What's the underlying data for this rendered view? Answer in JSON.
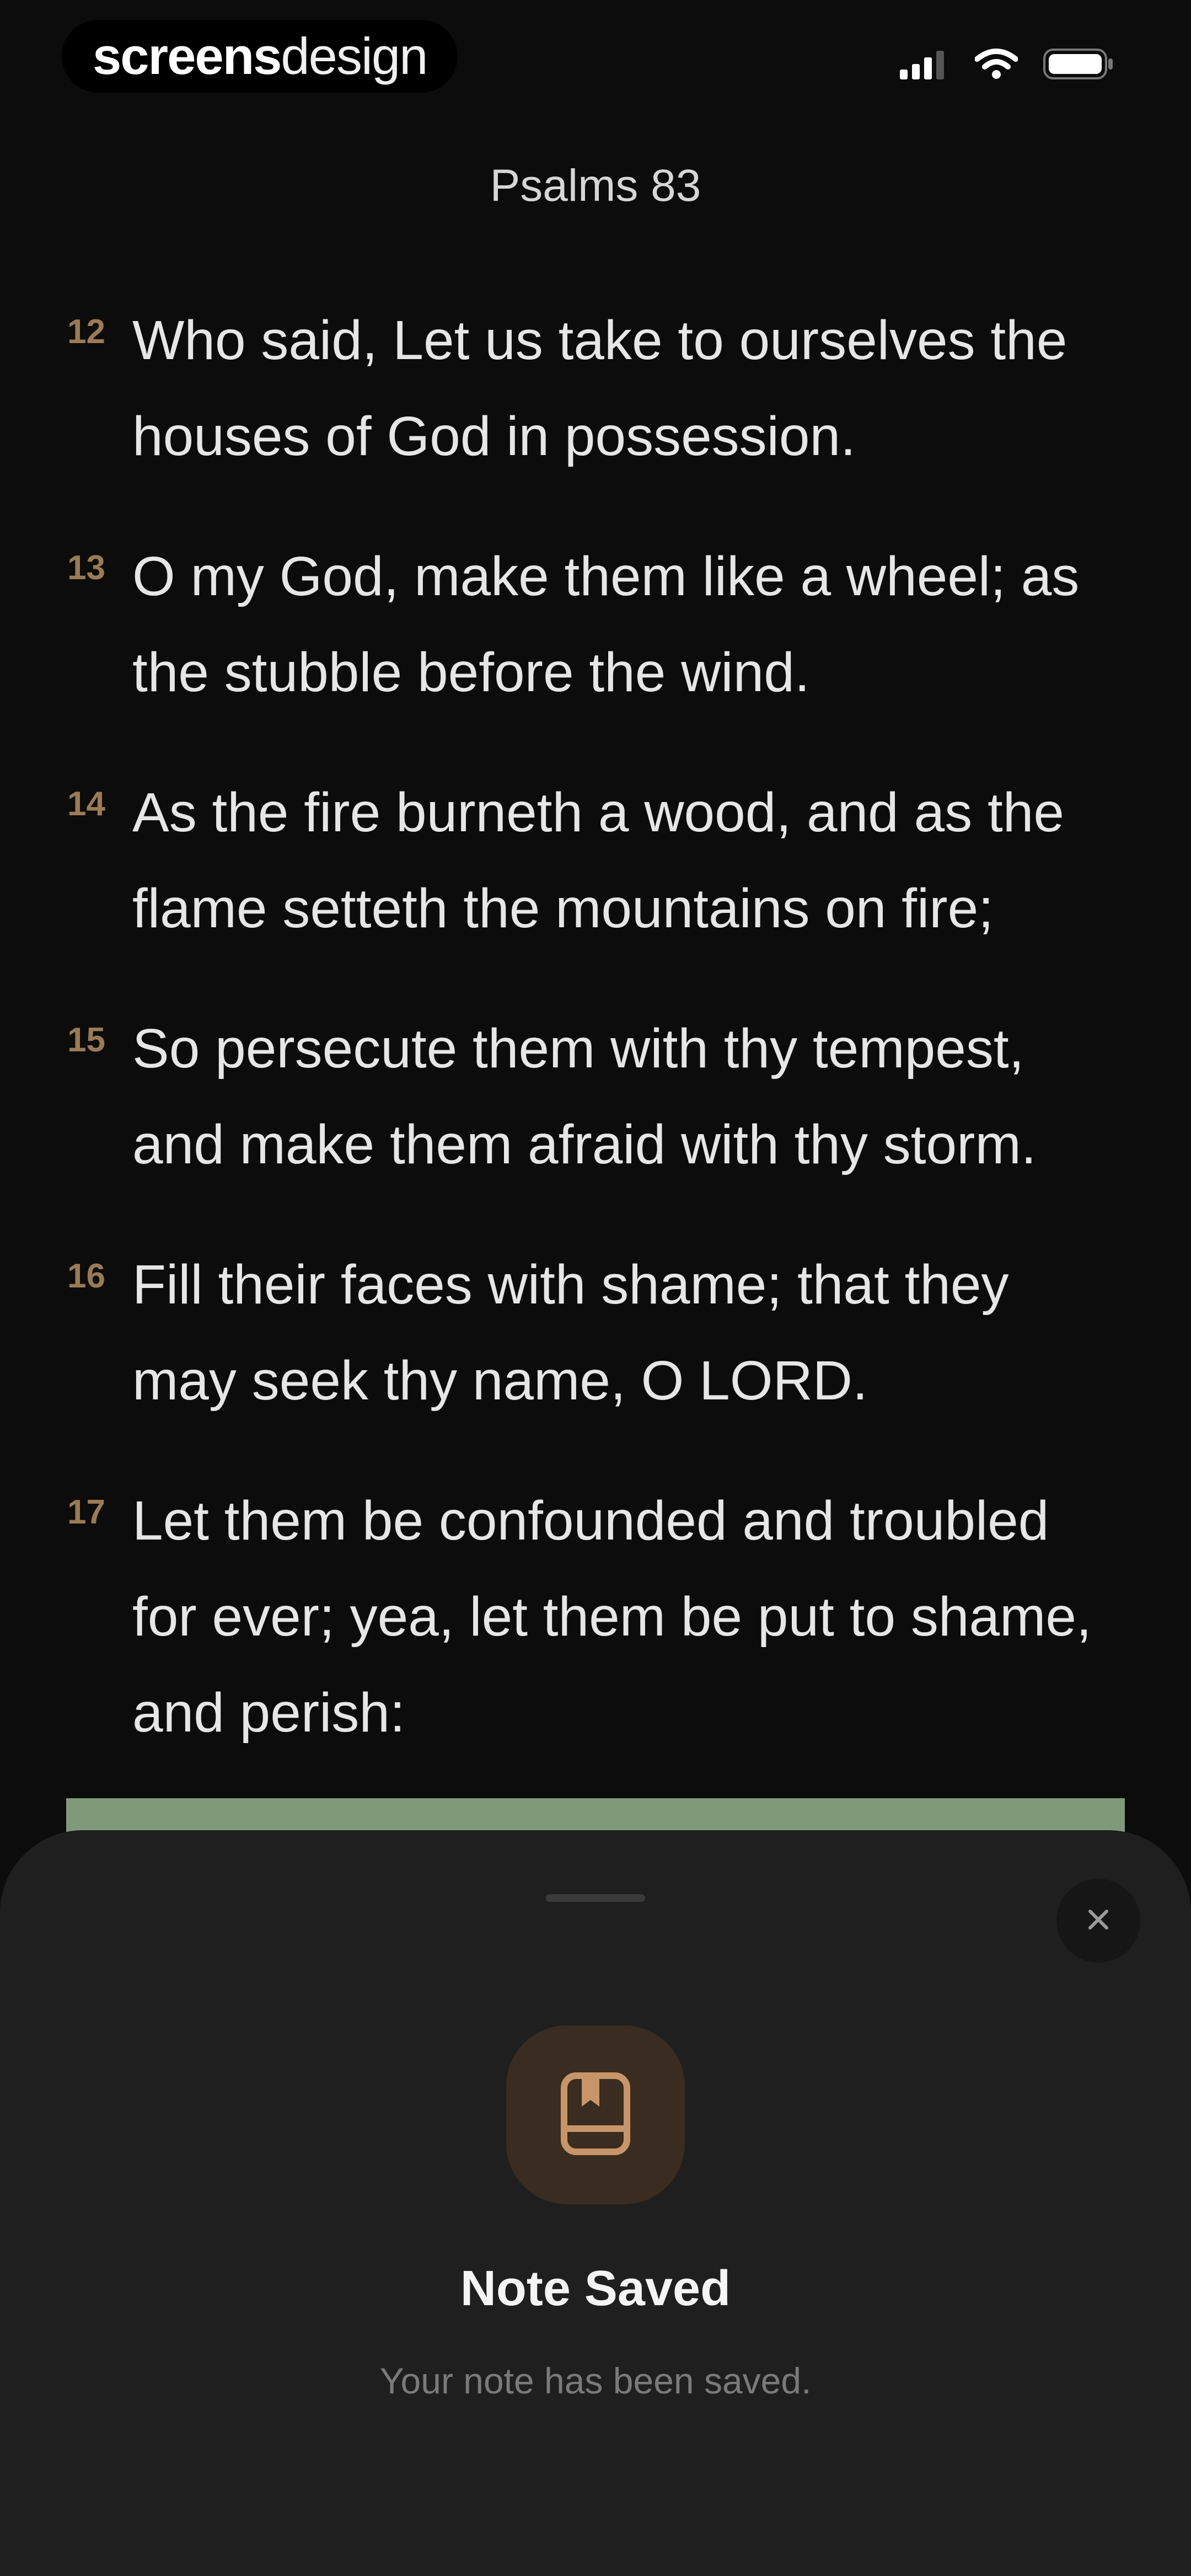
{
  "status_bar": {
    "brand_bold": "screens",
    "brand_light": "design",
    "icons": [
      "cellular-signal-icon",
      "wifi-icon",
      "battery-icon"
    ]
  },
  "header": {
    "title": "Psalms 83"
  },
  "verses": [
    {
      "number": "12",
      "text": "Who said, Let us take to ourselves the houses of God in possession."
    },
    {
      "number": "13",
      "text": "O my God, make them like a wheel; as the stubble before the wind."
    },
    {
      "number": "14",
      "text": "As the fire burneth a wood, and as the flame setteth the mountains on fire;"
    },
    {
      "number": "15",
      "text": "So persecute them with thy tempest, and make them afraid with thy storm."
    },
    {
      "number": "16",
      "text": "Fill their faces with shame; that they may seek thy name, O LORD."
    },
    {
      "number": "17",
      "text": "Let them be confounded and troubled for ever; yea, let them be put to shame, and perish:"
    }
  ],
  "sheet": {
    "title": "Note Saved",
    "message": "Your note has been saved.",
    "icon": "note-saved-icon",
    "close_icon": "close-icon"
  },
  "colors": {
    "background": "#0c0c0c",
    "verse_number": "#9b7b55",
    "highlight": "#7f9a78",
    "sheet": "#1f1f1f",
    "icon_tile": "#3a2c20",
    "icon_accent": "#c8956a"
  }
}
